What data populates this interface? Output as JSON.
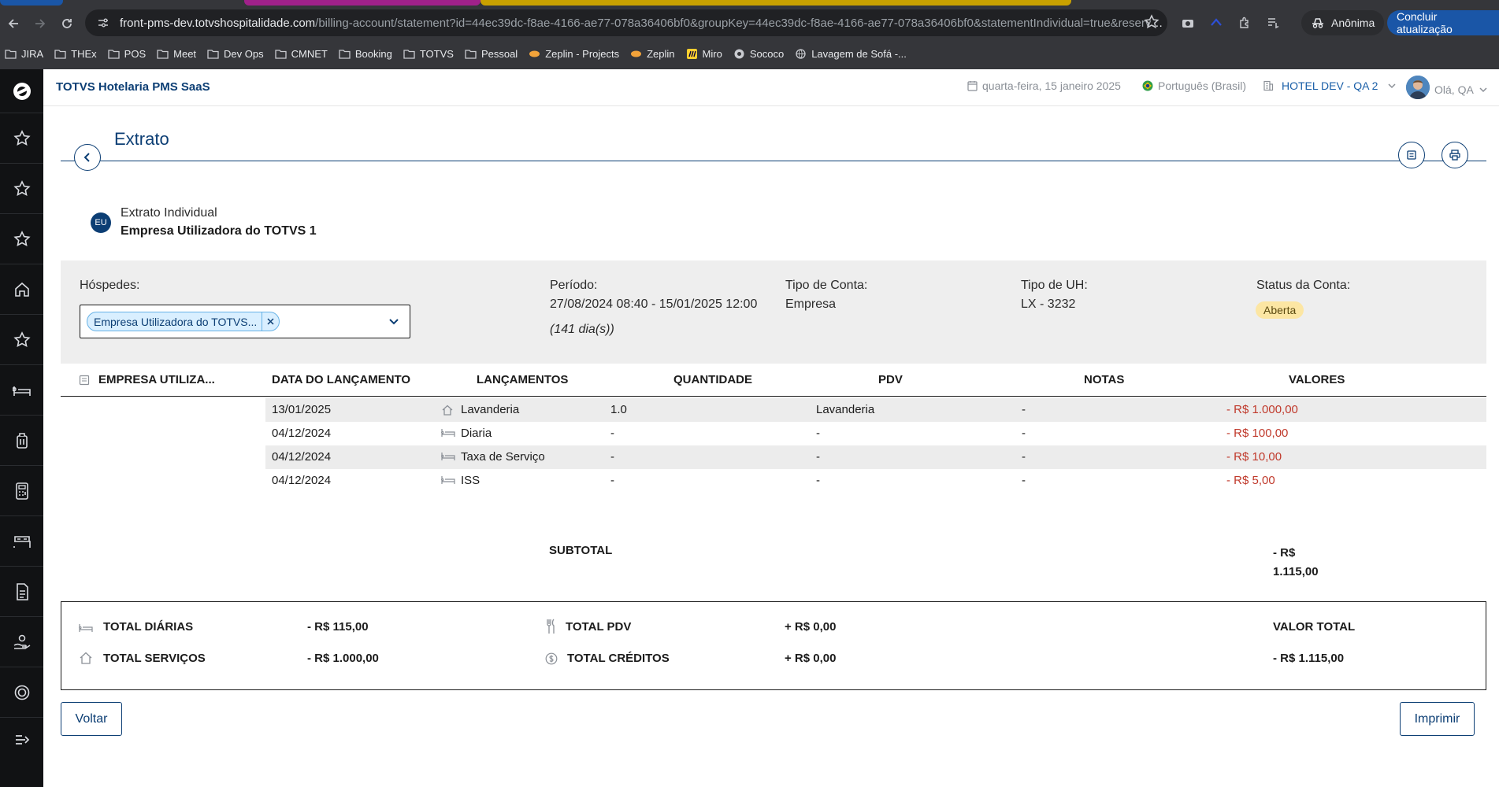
{
  "browser": {
    "url_host": "front-pms-dev.totvshospitalidade.com",
    "url_rest": "/billing-account/statement?id=44ec39dc-f8ae-4166-ae77-078a36406bf0&groupKey=44ec39dc-f8ae-4166-ae77-078a36406bf0&statementIndividual=true&reservationIt...",
    "incognito_label": "Anônima",
    "update_label": "Concluir atualização",
    "bookmarks": [
      "JIRA",
      "THEx",
      "POS",
      "Meet",
      "Dev Ops",
      "CMNET",
      "Booking",
      "TOTVS",
      "Pessoal",
      "Zeplin - Projects",
      "Zeplin",
      "Miro",
      "Sococo",
      "Lavagem de Sofá -..."
    ]
  },
  "topbar": {
    "brand": "TOTVS Hotelaria PMS SaaS",
    "date": "quarta-feira, 15 janeiro 2025",
    "language": "Português (Brasil)",
    "hotel": "HOTEL DEV - QA 2",
    "greeting": "Olá, QA"
  },
  "page": {
    "title": "Extrato",
    "holder_badge": "EU",
    "holder_type": "Extrato Individual",
    "holder_name": "Empresa Utilizadora do TOTVS 1"
  },
  "info": {
    "guests_label": "Hóspedes:",
    "guest_chip": "Empresa Utilizadora do TOTVS...",
    "period_label": "Período:",
    "period_value": "27/08/2024 08:40 - 15/01/2025 12:00",
    "period_days": "(141 dia(s))",
    "account_type_label": "Tipo de Conta:",
    "account_type_value": "Empresa",
    "uh_type_label": "Tipo de UH:",
    "uh_type_value": "LX - 3232",
    "status_label": "Status da Conta:",
    "status_value": "Aberta"
  },
  "table": {
    "headers": [
      "EMPRESA UTILIZA...",
      "DATA DO LANÇAMENTO",
      "LANÇAMENTOS",
      "QUANTIDADE",
      "PDV",
      "NOTAS",
      "VALORES"
    ],
    "rows": [
      {
        "date": "13/01/2025",
        "icon": "house-icon",
        "launch": "Lavanderia",
        "qty": "1.0",
        "pdv": "Lavanderia",
        "notes": "-",
        "value": "- R$ 1.000,00"
      },
      {
        "date": "04/12/2024",
        "icon": "bed-icon",
        "launch": "Diaria",
        "qty": "-",
        "pdv": "-",
        "notes": "-",
        "value": "- R$ 100,00"
      },
      {
        "date": "04/12/2024",
        "icon": "bed-icon",
        "launch": "Taxa de Serviço",
        "qty": "-",
        "pdv": "-",
        "notes": "-",
        "value": "- R$ 10,00"
      },
      {
        "date": "04/12/2024",
        "icon": "bed-icon",
        "launch": "ISS",
        "qty": "-",
        "pdv": "-",
        "notes": "-",
        "value": "- R$ 5,00"
      }
    ],
    "subtotal_label": "SUBTOTAL",
    "subtotal_line1": "- R$",
    "subtotal_line2": "1.115,00"
  },
  "totals": {
    "diarias_label": "TOTAL DIÁRIAS",
    "diarias_value": "- R$ 115,00",
    "servicos_label": "TOTAL SERVIÇOS",
    "servicos_value": "- R$ 1.000,00",
    "pdv_label": "TOTAL PDV",
    "pdv_value": "+ R$ 0,00",
    "creditos_label": "TOTAL CRÉDITOS",
    "creditos_value": "+ R$ 0,00",
    "valor_total_label": "VALOR TOTAL",
    "valor_total_value": "- R$ 1.115,00"
  },
  "actions": {
    "back_label": "Voltar",
    "print_label": "Imprimir"
  }
}
